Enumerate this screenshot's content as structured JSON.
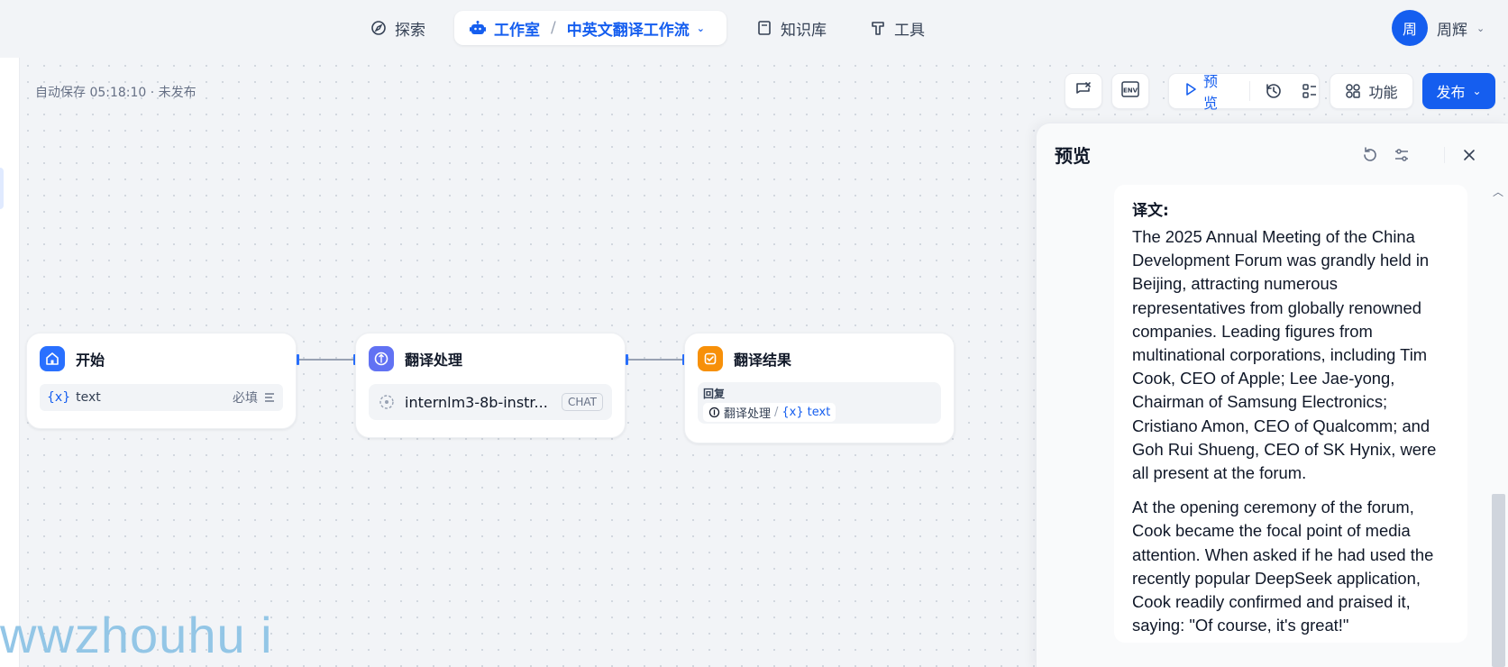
{
  "nav": {
    "explore": "探索",
    "studio": "工作室",
    "app_name": "中英文翻译工作流",
    "knowledge": "知识库",
    "tools": "工具",
    "user_avatar_letter": "周",
    "user_name": "周辉"
  },
  "canvas": {
    "autosave": "自动保存 05:18:10 · 未发布"
  },
  "toolbar": {
    "preview": "预览",
    "feature": "功能",
    "publish": "发布"
  },
  "nodes": {
    "start": {
      "title": "开始",
      "var_icon": "{x}",
      "var_name": "text",
      "required": "必填"
    },
    "llm": {
      "title": "翻译处理",
      "model": "internlm3-8b-instr...",
      "mode": "CHAT"
    },
    "end": {
      "title": "翻译结果",
      "reply_label": "回复",
      "ref_node": "翻译处理",
      "ref_sep": "/",
      "ref_var_icon": "{x}",
      "ref_var": "text"
    }
  },
  "preview_panel": {
    "title": "预览",
    "label": "译文:",
    "paragraph1": "The 2025 Annual Meeting of the China Development Forum was grandly held in Beijing, attracting numerous representatives from globally renowned companies. Leading figures from multinational corporations, including Tim Cook, CEO of Apple; Lee Jae-yong, Chairman of Samsung Electronics; Cristiano Amon, CEO of Qualcomm; and Goh Rui Shueng, CEO of SK Hynix, were all present at the forum.",
    "paragraph2": "At the opening ceremony of the forum, Cook became the focal point of media attention. When asked if he had used the recently popular DeepSeek application, Cook readily confirmed and praised it, saying: \"Of course, it's great!\""
  },
  "watermark": "wwzhouhu i",
  "colors": {
    "accent": "#155eef",
    "start_icon_bg": "#2970ff",
    "llm_icon_bg": "#6172f3",
    "end_icon_bg": "#f79009"
  }
}
